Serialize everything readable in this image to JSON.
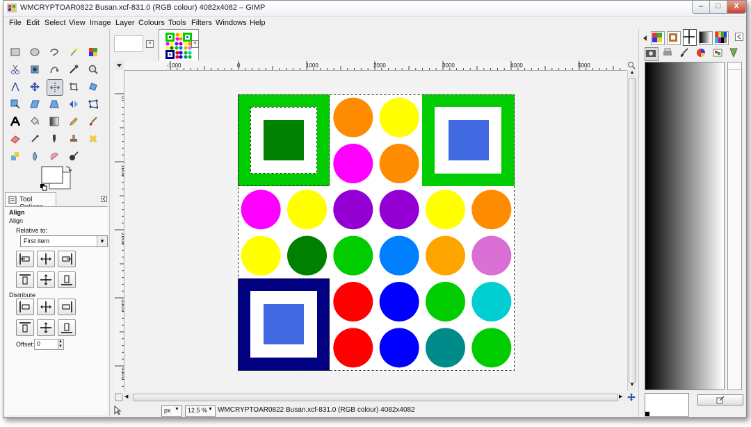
{
  "window": {
    "title": "WMCRYPTOAR0822 Busan.xcf-831.0 (RGB colour) 4082x4082 – GIMP",
    "controls": {
      "minimize": "–",
      "maximize": "□",
      "close": "X"
    }
  },
  "menu": [
    "File",
    "Edit",
    "Select",
    "View",
    "Image",
    "Layer",
    "Colours",
    "Tools",
    "Filters",
    "Windows",
    "Help"
  ],
  "tool_options": {
    "tab_label": "Tool Options",
    "heading": "Align",
    "subheading": "Align",
    "relative_label": "Relative to:",
    "relative_value": "First item",
    "distribute_label": "Distribute",
    "offset_label": "Offset:",
    "offset_value": "0"
  },
  "rulers": {
    "h_labels": [
      "-1000",
      "0",
      "1000",
      "2000",
      "3000",
      "4000",
      "5000"
    ],
    "v_labels": [
      "0",
      "1000",
      "2000",
      "3000",
      "4000"
    ]
  },
  "canvas_image": {
    "colors": {
      "green": "#00cc00",
      "dark_green": "#008000",
      "navy": "#000080",
      "royal_blue": "#4169e1",
      "orange": "#ff8c00",
      "yellow": "#ffff00",
      "magenta": "#ff00ff",
      "purple": "#9400d3",
      "azure": "#0080ff",
      "orange2": "#ffa500",
      "orchid": "#da70d6",
      "red": "#ff0000",
      "blue": "#0000ff",
      "teal": "#008b8b",
      "turquoise": "#00ced1"
    },
    "circle_rows": [
      [
        "",
        "",
        "orange",
        "yellow",
        "",
        ""
      ],
      [
        "",
        "",
        "magenta",
        "orange",
        "",
        ""
      ],
      [
        "magenta",
        "yellow",
        "purple",
        "purple",
        "yellow",
        "orange"
      ],
      [
        "yellow",
        "dark_green",
        "green",
        "azure",
        "orange2",
        "orchid"
      ],
      [
        "",
        "",
        "red",
        "blue",
        "green",
        "turquoise"
      ],
      [
        "",
        "",
        "red",
        "blue",
        "teal",
        "green"
      ]
    ]
  },
  "status": {
    "unit": "px",
    "zoom": "12.5 %",
    "text": "WMCRYPTOAR0822 Busan.xcf-831.0 (RGB colour) 4082x4082"
  }
}
